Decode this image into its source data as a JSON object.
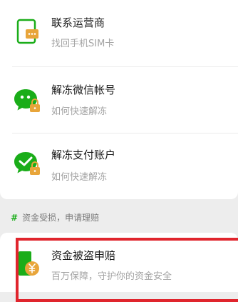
{
  "items": [
    {
      "title": "联系运营商",
      "subtitle": "找回手机SIM卡",
      "icon": "sim-card-phone-icon"
    },
    {
      "title": "解冻微信帐号",
      "subtitle": "如何快速解冻",
      "icon": "wechat-lock-icon"
    },
    {
      "title": "解冻支付账户",
      "subtitle": "如何快速解冻",
      "icon": "wechat-pay-lock-icon"
    }
  ],
  "section": {
    "hash": "#",
    "header": "资金受损，申请理赔"
  },
  "claim_item": {
    "title": "资金被盗申赔",
    "subtitle": "百万保障，守护你的资金安全",
    "icon": "money-claim-icon"
  },
  "colors": {
    "brand_green": "#1aad19",
    "highlight_red": "#e0252d",
    "lock_orange": "#e8a53a"
  }
}
